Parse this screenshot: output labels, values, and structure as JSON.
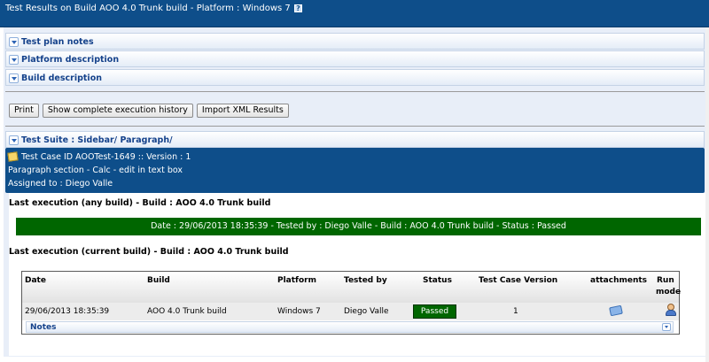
{
  "title": {
    "text": "Test Results on Build AOO 4.0 Trunk build - Platform : Windows 7",
    "help_icon": "question-mark"
  },
  "panels": {
    "test_plan_notes": "Test plan notes",
    "platform_description": "Platform description",
    "build_description": "Build description"
  },
  "buttons": {
    "print": "Print",
    "history": "Show complete execution history",
    "import_xml": "Import XML Results"
  },
  "test_suite": {
    "label": "Test Suite : Sidebar/ Paragraph/"
  },
  "test_case": {
    "line1": "Test Case ID AOOTest-1649 :: Version : 1",
    "line2": "Paragraph section - Calc - edit in text box",
    "line3": "Assigned to : Diego Valle"
  },
  "last_any": {
    "heading": "Last execution (any build) - Build : AOO 4.0 Trunk build",
    "summary": "Date : 29/06/2013 18:35:39 - Tested by : Diego Valle - Build : AOO 4.0 Trunk build - Status : Passed"
  },
  "last_current": {
    "heading": "Last execution (current build) - Build : AOO 4.0 Trunk build"
  },
  "table": {
    "headers": {
      "date": "Date",
      "build": "Build",
      "platform": "Platform",
      "tested_by": "Tested by",
      "status": "Status",
      "tc_version": "Test Case Version",
      "attachments": "attachments",
      "run": "Run",
      "mode": "mode"
    },
    "row": {
      "date": "29/06/2013 18:35:39",
      "build": "AOO 4.0 Trunk build",
      "platform": "Windows 7",
      "tested_by": "Diego Valle",
      "status": "Passed",
      "tc_version": "1"
    },
    "notes_label": "Notes"
  },
  "colors": {
    "header_blue": "#0e4e8a",
    "passed_green": "#006600",
    "panel_text": "#15428b"
  }
}
